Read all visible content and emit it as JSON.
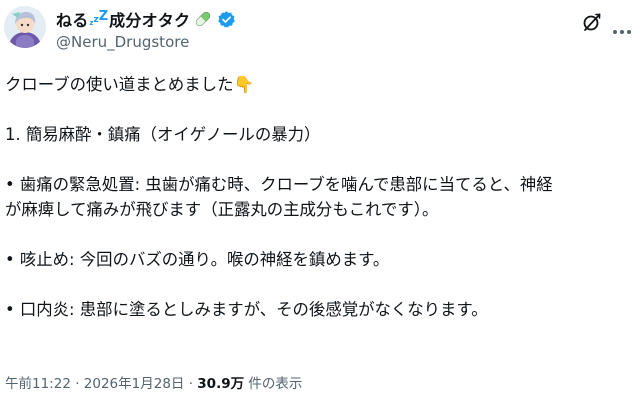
{
  "user": {
    "display_name_prefix": "ねる",
    "zz": [
      "z",
      "z",
      "Z"
    ],
    "display_name_suffix": "成分オタク",
    "handle": "@Neru_Drugstore"
  },
  "post": {
    "lines": [
      "クローブの使い道まとめました👇",
      "",
      "1. 簡易麻酔・鎮痛（オイゲノールの暴力）",
      "",
      "• 歯痛の緊急処置: 虫歯が痛む時、クローブを噛んで患部に当てると、神経",
      "が麻痺して痛みが飛びます（正露丸の主成分もこれです）。",
      "",
      "• 咳止め: 今回のバズの通り。喉の神経を鎮めます。",
      "",
      "• 口内炎: 患部に塗るとしみますが、その後感覚がなくなります。"
    ]
  },
  "meta": {
    "time": "午前11:22",
    "sep1": " · ",
    "date": "2026年1月28日",
    "sep2": " · ",
    "views_count": "30.9万",
    "views_label": " 件の表示"
  },
  "icons": {
    "verified": "verified-badge-icon",
    "pill": "pill-icon",
    "grok": "grok-icon",
    "more": "more-options-icon"
  },
  "colors": {
    "text": "#0f1419",
    "secondary": "#536471",
    "accent": "#1d9bf0",
    "pill_green": "#7bc96f"
  }
}
